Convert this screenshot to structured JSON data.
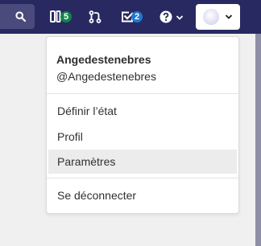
{
  "topbar": {
    "search_icon": "search-icon",
    "todos_icon": "issues-icon",
    "issues_count": "5",
    "merge_requests_icon": "merge-request-icon",
    "todo_icon": "todo-check-icon",
    "todos_count": "2",
    "help_icon": "question-circle-icon",
    "user_avatar_icon": "unicorn-avatar-icon",
    "colors": {
      "bar": "#292961",
      "badge_green": "#108548",
      "badge_blue": "#1f78d1"
    }
  },
  "user_menu": {
    "name": "Angedestenebres",
    "handle": "@Angedestenebres",
    "items": [
      {
        "label": "Définir l’état",
        "active": false
      },
      {
        "label": "Profil",
        "active": false
      },
      {
        "label": "Paramètres",
        "active": true
      },
      {
        "label": "Se déconnecter",
        "active": false
      }
    ]
  }
}
